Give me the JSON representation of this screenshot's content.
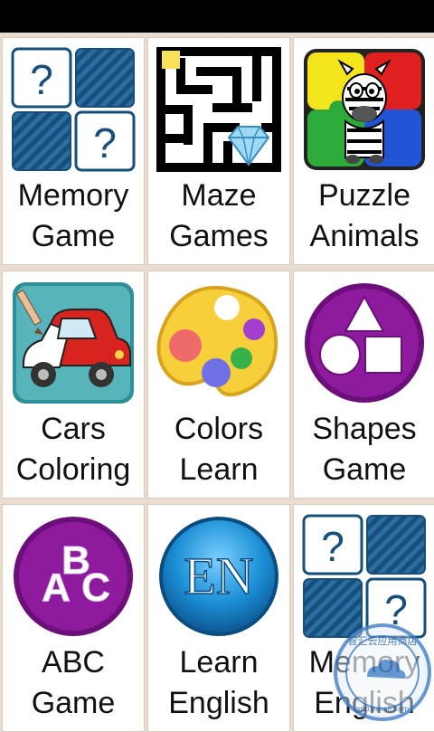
{
  "tiles": [
    {
      "line1": "Memory",
      "line2": "Game",
      "icon": "memory-cards-icon"
    },
    {
      "line1": "Maze",
      "line2": "Games",
      "icon": "maze-icon"
    },
    {
      "line1": "Puzzle",
      "line2": "Animals",
      "icon": "zebra-puzzle-icon"
    },
    {
      "line1": "Cars",
      "line2": "Coloring",
      "icon": "car-coloring-icon"
    },
    {
      "line1": "Colors",
      "line2": "Learn",
      "icon": "palette-icon"
    },
    {
      "line1": "Shapes",
      "line2": "Game",
      "icon": "shapes-icon"
    },
    {
      "line1": "ABC",
      "line2": "Game",
      "icon": "abc-icon"
    },
    {
      "line1": "Learn",
      "line2": "English",
      "icon": "en-icon"
    },
    {
      "line1": "Memory",
      "line2": "English",
      "icon": "memory-cards-icon"
    }
  ],
  "memory_icon": {
    "mark": "?"
  },
  "abc_icon": {
    "letters": [
      "A",
      "B",
      "C"
    ]
  },
  "en_icon": {
    "text": "EN"
  },
  "watermark": {
    "text": "智汇云应用商店",
    "url": "app.vmall.com"
  },
  "colors": {
    "background": "#e9ddd1",
    "memory_blue": "#1f5f8f",
    "purple": "#8e1b9e",
    "en_blue": "#1c8fd6"
  }
}
